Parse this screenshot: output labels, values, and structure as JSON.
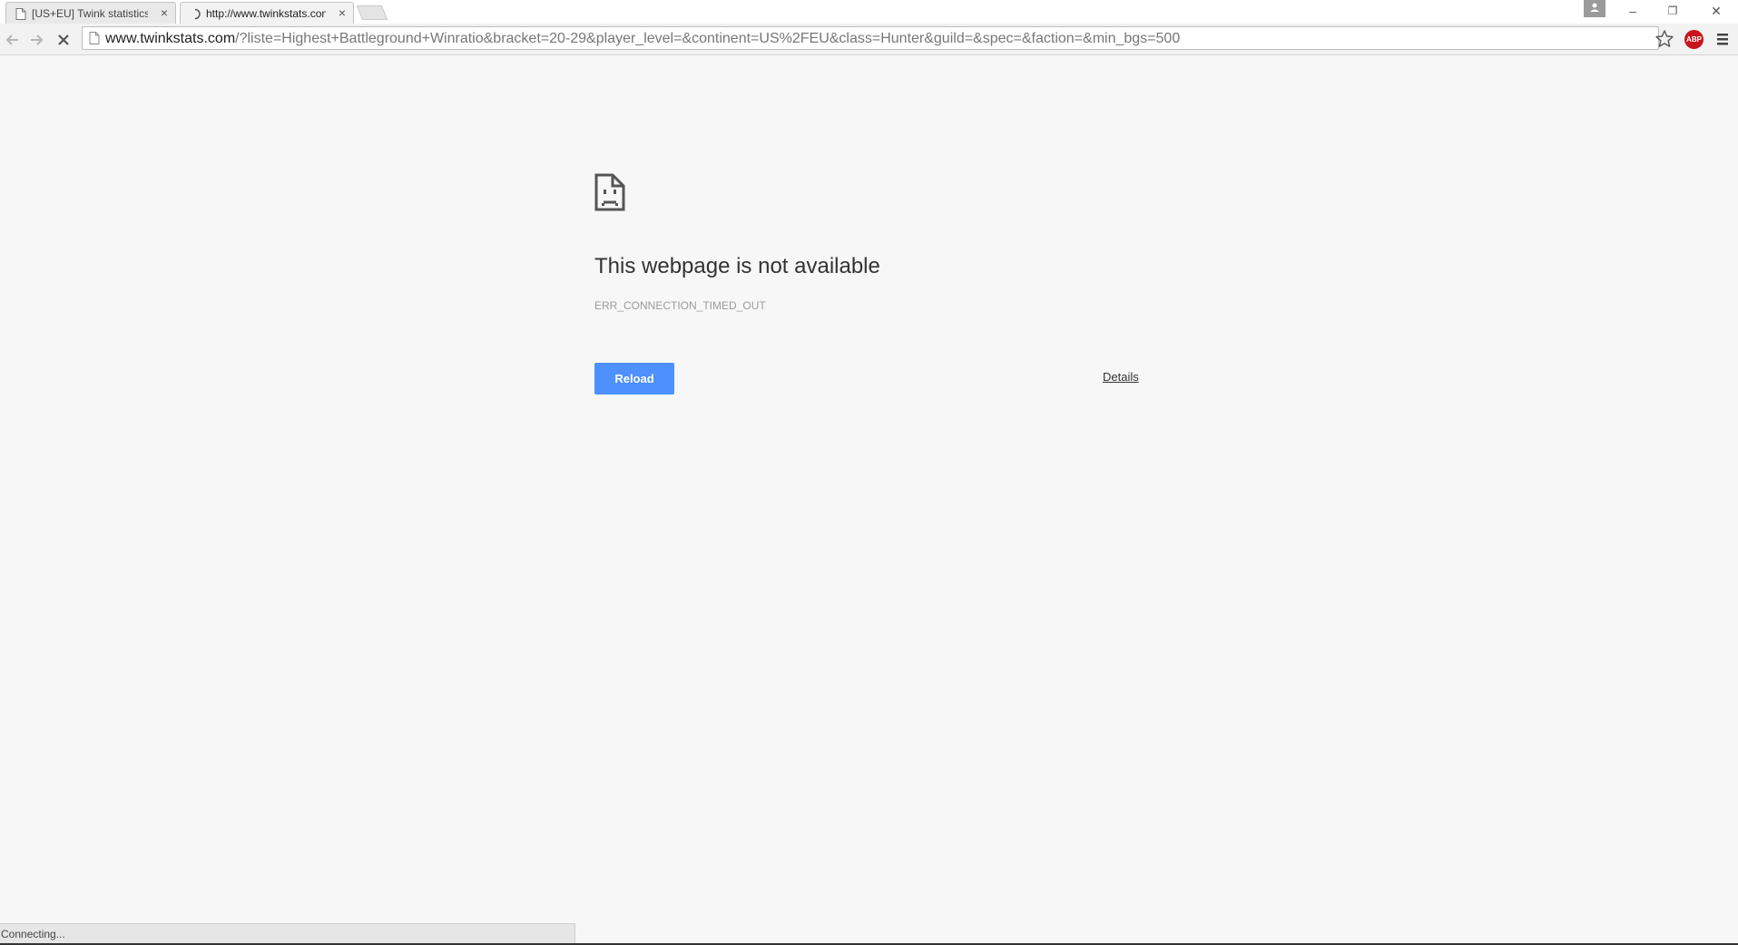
{
  "tabs": [
    {
      "title": "[US+EU] Twink statistics o",
      "close": "×"
    },
    {
      "title": "http://www.twinkstats.con",
      "close": "×"
    }
  ],
  "window_controls": {
    "minimize": "–",
    "restore": "❐",
    "close": "✕"
  },
  "omnibox": {
    "host": "www.twinkstats.com",
    "path": "/?liste=Highest+Battleground+Winratio&bracket=20-29&player_level=&continent=US%2FEU&class=Hunter&guild=&spec=&faction=&min_bgs=500"
  },
  "extension": {
    "abp_label": "ABP"
  },
  "error_page": {
    "heading": "This webpage is not available",
    "error_code": "ERR_CONNECTION_TIMED_OUT",
    "reload_label": "Reload",
    "details_label": "Details"
  },
  "status": {
    "text": "Connecting..."
  },
  "colors": {
    "reload_button": "#4d90fe",
    "abp_badge": "#c8141b"
  }
}
